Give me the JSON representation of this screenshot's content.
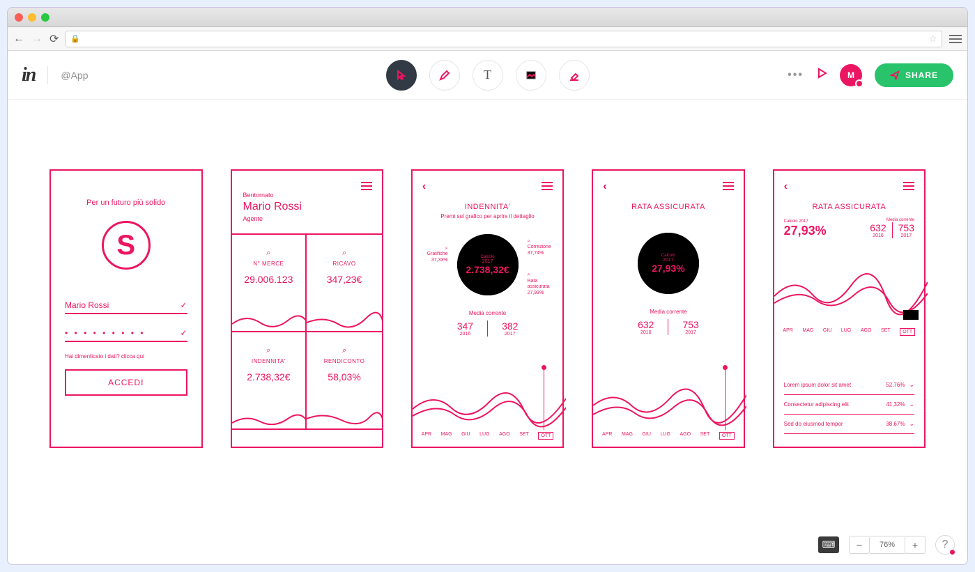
{
  "app": {
    "logo": "in",
    "breadcrumb": "@App",
    "share_label": "SHARE",
    "avatar_initial": "M"
  },
  "zoom": {
    "value": "76%"
  },
  "artboards": {
    "login": {
      "tagline": "Per un futuro più solido",
      "logo_letter": "S",
      "username": "Mario Rossi",
      "password_mask": "• • • • • • • • •",
      "forgot": "Hai dimenticato i dati? clicca qui",
      "button": "ACCEDI"
    },
    "dashboard": {
      "welcome": "Bentornato",
      "name": "Mario Rossi",
      "role": "Agente",
      "cells": [
        {
          "label": "N° MERCE",
          "value": "29.006.123"
        },
        {
          "label": "RICAVO",
          "value": "347,23€"
        },
        {
          "label": "INDENNITA'",
          "value": "2.738,32€"
        },
        {
          "label": "RENDICONTO",
          "value": "58,03%"
        }
      ]
    },
    "indennita": {
      "title": "INDENNITA'",
      "subtitle": "Premi sul grafico per aprire il dettaglio",
      "center_label": "Calcolo",
      "center_year": "2017",
      "center_value": "2.738,32€",
      "side1_label": "Gratifiche",
      "side1_val": "37,33%",
      "side2_label": "Correzione",
      "side2_val": "37,74%",
      "side3_label": "Rata assicurata",
      "side3_val": "27,93%",
      "media_label": "Media corrente",
      "media_a_val": "347",
      "media_a_year": "2016",
      "media_b_val": "382",
      "media_b_year": "2017",
      "months": [
        "APR",
        "MAG",
        "GIU",
        "LUG",
        "AGO",
        "SET",
        "OTT"
      ]
    },
    "rata": {
      "title": "RATA ASSICURATA",
      "center_label": "Calcolo",
      "center_year": "2017",
      "center_value": "27,93%",
      "media_label": "Media corrente",
      "media_a_val": "632",
      "media_a_year": "2016",
      "media_b_val": "753",
      "media_b_year": "2017",
      "months": [
        "APR",
        "MAG",
        "GIU",
        "LUG",
        "AGO",
        "SET",
        "OTT"
      ]
    },
    "rata_detail": {
      "title": "RATA ASSICURATA",
      "calc_label": "Calcolo",
      "calc_year": "2017",
      "calc_value": "27,93%",
      "media_label": "Media corrente",
      "media_a_val": "632",
      "media_a_year": "2016",
      "media_b_val": "753",
      "media_b_year": "2017",
      "months": [
        "APR",
        "MAG",
        "GIU",
        "LUG",
        "AGO",
        "SET",
        "OTT"
      ],
      "list": [
        {
          "text": "Lorem ipsum dolor sit amet",
          "pct": "52,76%"
        },
        {
          "text": "Consectetur adipiscing elit",
          "pct": "41,32%"
        },
        {
          "text": "Sed do eiusmod tempor",
          "pct": "38,67%"
        }
      ]
    }
  }
}
